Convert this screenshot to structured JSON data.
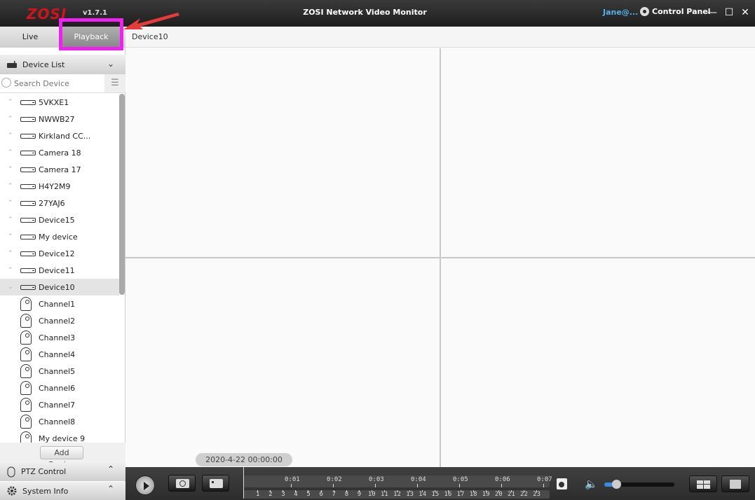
{
  "titlebar": {
    "logo": "ZOSI",
    "version": "v1.7.1",
    "title": "ZOSI Network Video Monitor",
    "user": "Jane@...",
    "control_panel": "Control Panel",
    "minimize": "—",
    "maximize": "☐",
    "close": "✕"
  },
  "tabs": {
    "live": "Live",
    "playback": "Playback",
    "active": "Playback"
  },
  "device_tab": "Device10",
  "sidebar": {
    "device_list_label": "Device List",
    "search_placeholder": "Search Device",
    "devices": [
      {
        "name": "5VKXE1",
        "expanded": false
      },
      {
        "name": "NWWB27",
        "expanded": false
      },
      {
        "name": "Kirkland CC...",
        "expanded": false
      },
      {
        "name": "Camera 18",
        "expanded": false
      },
      {
        "name": "Camera 17",
        "expanded": false
      },
      {
        "name": "H4Y2M9",
        "expanded": false
      },
      {
        "name": "27YAJ6",
        "expanded": false
      },
      {
        "name": "Device15",
        "expanded": false
      },
      {
        "name": "My device",
        "expanded": false
      },
      {
        "name": "Device12",
        "expanded": false
      },
      {
        "name": "Device11",
        "expanded": false
      },
      {
        "name": "Device10",
        "expanded": true,
        "selected": true
      }
    ],
    "channels": [
      "Channel1",
      "Channel2",
      "Channel3",
      "Channel4",
      "Channel5",
      "Channel6",
      "Channel7",
      "Channel8",
      "My device 9"
    ],
    "add_device": "Add Device",
    "ptz_control": "PTZ Control",
    "system_info": "System Info"
  },
  "playback": {
    "datetime": "2020-4-22 00:00:00",
    "timeline_top_labels": [
      "0:01",
      "0:02",
      "0:03",
      "0:04",
      "0:05",
      "0:06",
      "0:07"
    ],
    "timeline_bottom_labels": [
      "1",
      "2",
      "3",
      "4",
      "5",
      "6",
      "7",
      "8",
      "9",
      "10",
      "11",
      "12",
      "13",
      "14",
      "15",
      "16",
      "17",
      "18",
      "19",
      "20",
      "21",
      "22",
      "23"
    ],
    "volume_percent": 15
  },
  "annotation": {
    "highlight_color": "#f020f0",
    "arrow_color": "#e83a3a"
  }
}
